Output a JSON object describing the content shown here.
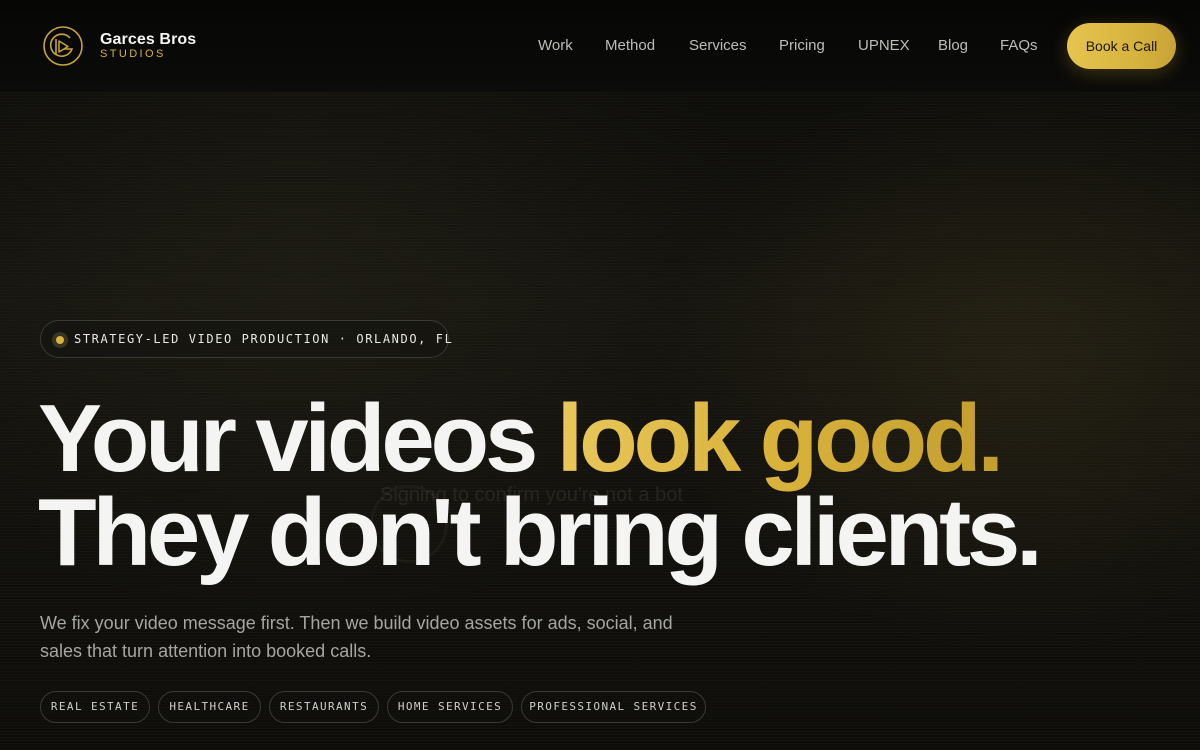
{
  "brand": {
    "name": "Garces Bros",
    "subtitle": "STUDIOS",
    "logo_icon": "gb-play-logo-icon",
    "accent_color": "#d8b23a"
  },
  "nav": {
    "items": [
      {
        "label": "Work"
      },
      {
        "label": "Method"
      },
      {
        "label": "Services"
      },
      {
        "label": "Pricing"
      },
      {
        "label": "UPNEX"
      },
      {
        "label": "Blog"
      },
      {
        "label": "FAQs"
      }
    ],
    "cta_label": "Book a Call"
  },
  "hero": {
    "eyebrow": "STRATEGY-LED VIDEO PRODUCTION · ORLANDO, FL",
    "headline_line1_white": "Your videos ",
    "headline_line1_gold": "look good.",
    "headline_line2": "They don't bring clients.",
    "subtitle": "We fix your video message first. Then we build video assets for ads, social, and sales that turn attention into booked calls.",
    "overlay_ghost_text": "Signing to confirm you're not a bot"
  },
  "industries": [
    {
      "label": "REAL ESTATE"
    },
    {
      "label": "HEALTHCARE"
    },
    {
      "label": "RESTAURANTS"
    },
    {
      "label": "HOME SERVICES"
    },
    {
      "label": "PROFESSIONAL SERVICES"
    }
  ]
}
